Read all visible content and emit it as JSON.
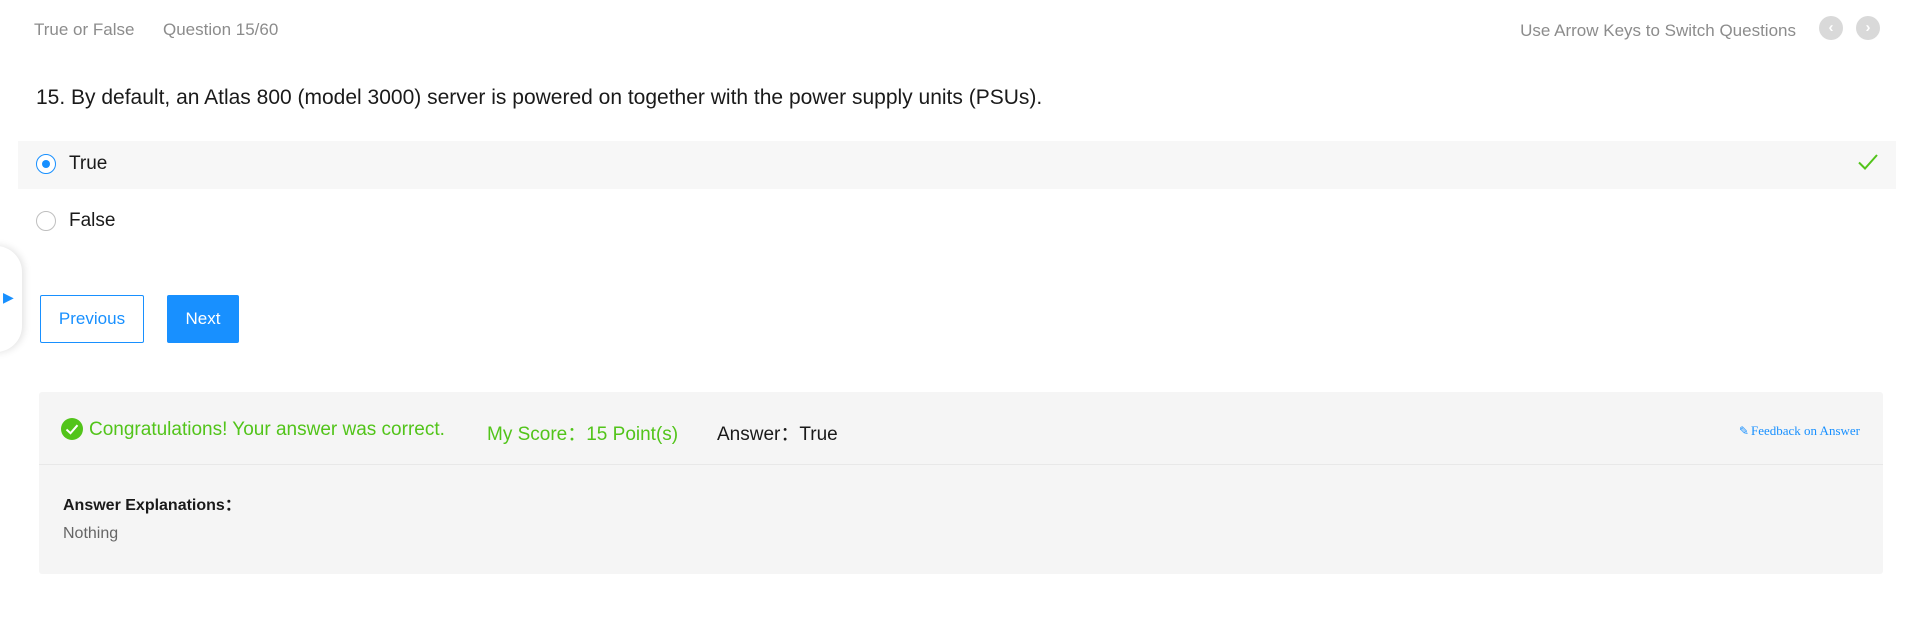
{
  "header": {
    "question_type": "True or False",
    "question_counter": "Question 15/60",
    "hint": "Use Arrow Keys to Switch Questions",
    "prev_icon": "‹",
    "next_icon": "›"
  },
  "question": {
    "text": "15. By default, an Atlas 800 (model 3000) server is powered on together with the power supply units (PSUs).",
    "options": [
      {
        "label": "True",
        "selected": true,
        "correct": true
      },
      {
        "label": "False",
        "selected": false,
        "correct": false
      }
    ]
  },
  "side_tab": {
    "arrow": "▶"
  },
  "buttons": {
    "previous": "Previous",
    "next": "Next"
  },
  "result": {
    "message": "Congratulations! Your answer was correct.",
    "score": "My Score：15 Point(s)",
    "answer": "Answer：True",
    "feedback_label": "Feedback on Answer",
    "feedback_icon": "✎",
    "explanation_title": "Answer Explanations：",
    "explanation_text": "Nothing"
  },
  "colors": {
    "accent": "#1890ff",
    "success": "#52c41a",
    "muted": "#8c8c8c"
  }
}
